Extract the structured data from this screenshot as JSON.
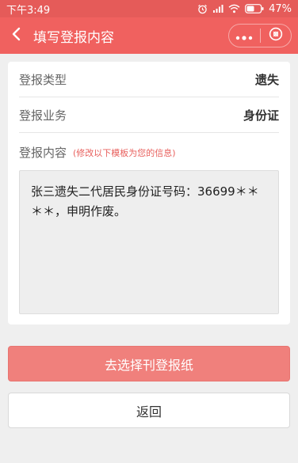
{
  "status_bar": {
    "time": "下午3:49",
    "battery": "47%",
    "icons": [
      "alarm-icon",
      "signal-icon",
      "wifi-icon",
      "battery-icon"
    ]
  },
  "nav": {
    "title": "填写登报内容",
    "back_icon": "chevron-left-icon",
    "more_icon": "more-dots-icon",
    "close_icon": "close-circle-icon"
  },
  "form": {
    "type_label": "登报类型",
    "type_value": "遗失",
    "business_label": "登报业务",
    "business_value": "身份证",
    "content_label": "登报内容",
    "content_hint": "(修改以下模板为您的信息)",
    "content_value": "张三遗失二代居民身份证号码：36699＊＊＊＊，申明作废。"
  },
  "actions": {
    "primary_label": "去选择刊登报纸",
    "secondary_label": "返回"
  },
  "colors": {
    "brand": "#f0615f",
    "primary_button": "#f0807c",
    "hint": "#e8605d"
  }
}
